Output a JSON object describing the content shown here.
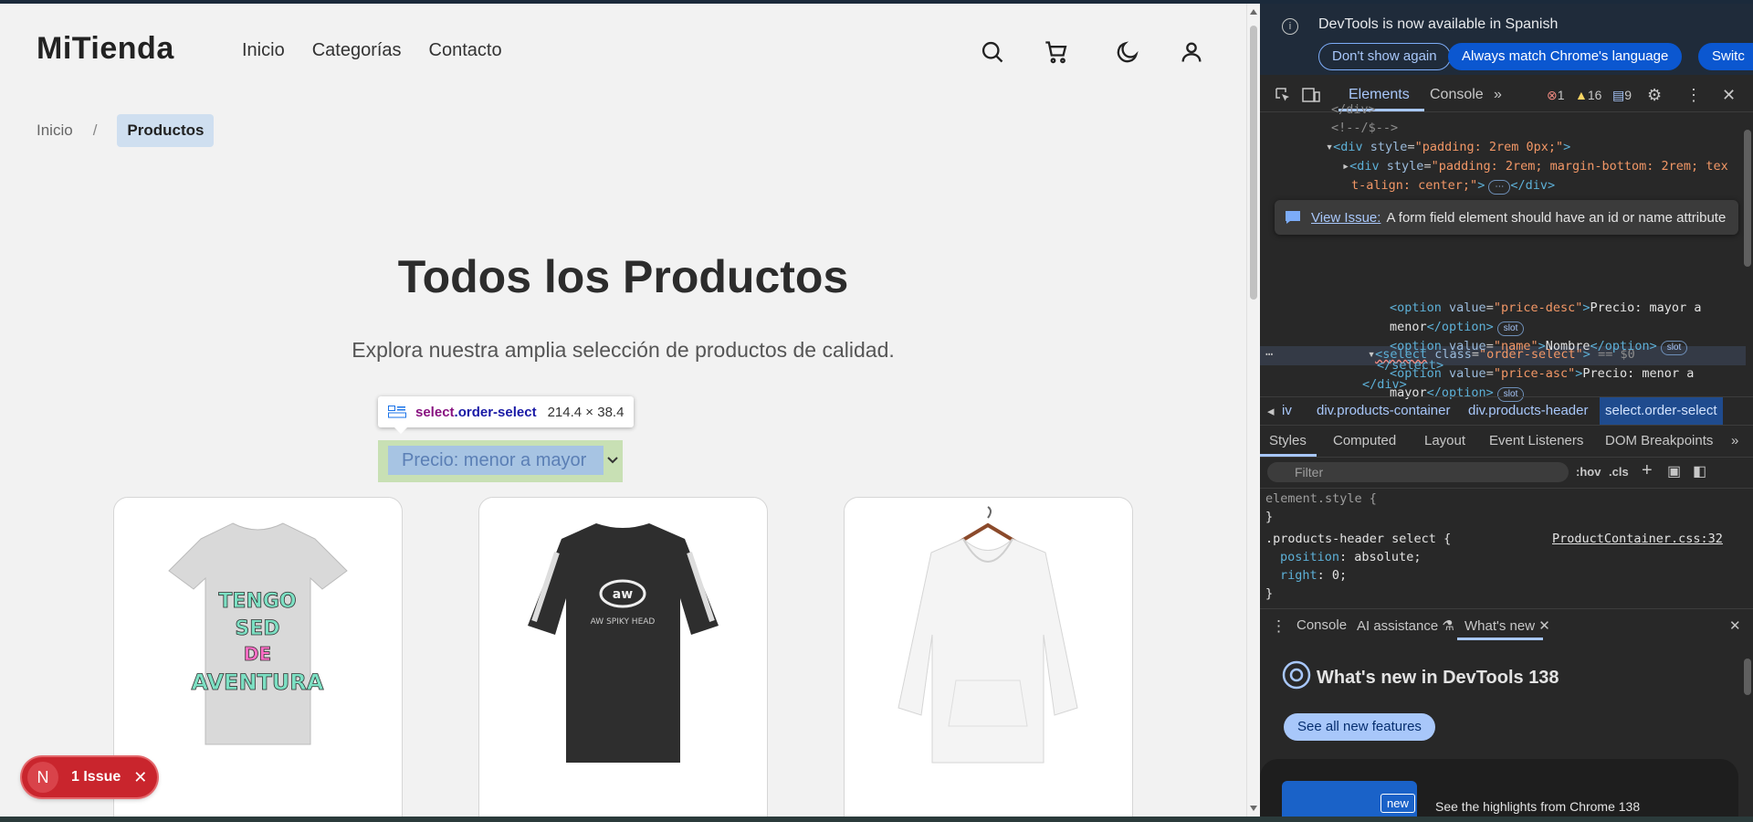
{
  "site": {
    "logo": "MiTienda",
    "nav": [
      "Inicio",
      "Categorías",
      "Contacto"
    ],
    "breadcrumb": {
      "home": "Inicio",
      "separator": "/",
      "current": "Productos"
    },
    "title": "Todos los Productos",
    "subtitle": "Explora nuestra amplia selección de productos de calidad.",
    "sort_select": {
      "value": "Precio: menor a mayor"
    },
    "inspect_tooltip": {
      "tag": "select",
      "class": ".order-select",
      "dimensions": "214.4 × 38.4"
    },
    "products": [
      {
        "image": "t-shirt",
        "colors": {
          "shirt": "#d9d9d9"
        }
      },
      {
        "image": "jersey",
        "colors": {
          "shirt": "#2e2e2e"
        }
      },
      {
        "image": "hoodie",
        "colors": {
          "shirt": "#f4f4f4"
        }
      }
    ],
    "issue_pill": {
      "letter": "N",
      "label": "1 Issue"
    }
  },
  "devtools": {
    "infobar": {
      "message": "DevTools is now available in Spanish",
      "btn_dont_show": "Don't show again",
      "btn_match": "Always match Chrome's language",
      "btn_switch": "Switc"
    },
    "tabs": {
      "elements": "Elements",
      "console": "Console",
      "more": "»"
    },
    "counts": {
      "errors": "1",
      "warnings": "16",
      "messages": "9"
    },
    "code": {
      "l0": "<!--/$-->",
      "div1_style": "padding: 2rem 0px;",
      "div2_style_a": "padding: 2rem; margin-bottom: 2rem; tex",
      "div2_style_b": "t-align: center;",
      "select_class": "order-select",
      "select_eq": "== $0",
      "opt1_value": "price-asc",
      "opt1_text_a": "Precio: menor a",
      "opt1_text_b": "mayor",
      "opt2_value": "price-desc",
      "opt2_text_a": "Precio: mayor a",
      "opt2_text_b": "menor",
      "opt3_value": "name",
      "opt3_text": "Nombre",
      "slot": "slot"
    },
    "issue_popup": {
      "link": "View Issue:",
      "text": "A form field element should have an id or name attribute"
    },
    "breadcrumbs": [
      "iv",
      "div.products-container",
      "div.products-header",
      "select.order-select"
    ],
    "style_tabs": [
      "Styles",
      "Computed",
      "Layout",
      "Event Listeners",
      "DOM Breakpoints"
    ],
    "filter": {
      "placeholder": "Filter",
      "hov": ":hov",
      "cls": ".cls"
    },
    "rules": {
      "element_style": "element.style {",
      "close": "}",
      "selector": ".products-header select {",
      "source": "ProductContainer.css:32",
      "p1_name": "position",
      "p1_value": "absolute;",
      "p2_name": "right",
      "p2_value": "0;"
    },
    "drawer": {
      "console": "Console",
      "ai": "AI assistance",
      "whatsnew": "What's new"
    },
    "whatsnew": {
      "title": "What's new in DevTools 138",
      "see_all": "See all new features",
      "highlight": "See the highlights from Chrome 138",
      "new_badge": "new"
    }
  },
  "colors": {
    "accent": "#a8c7fa",
    "page_bg": "#f2f2f2",
    "devtools_bg": "#282828",
    "issue_red": "#c9252d"
  }
}
